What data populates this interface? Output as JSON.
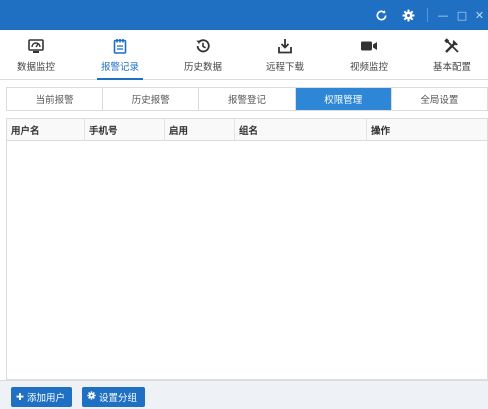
{
  "window": {
    "controls": {
      "refresh": "refresh-icon",
      "settings": "gear-icon",
      "minimize": "—",
      "maximize": "□",
      "close": "✕"
    }
  },
  "nav": {
    "items": [
      {
        "label": "数据监控",
        "icon": "monitor-icon"
      },
      {
        "label": "报警记录",
        "icon": "alarm-clipboard-icon",
        "active": true
      },
      {
        "label": "历史数据",
        "icon": "history-clock-icon"
      },
      {
        "label": "远程下载",
        "icon": "download-tray-icon"
      },
      {
        "label": "视频监控",
        "icon": "video-camera-icon"
      },
      {
        "label": "基本配置",
        "icon": "tools-icon"
      }
    ]
  },
  "tabs": [
    {
      "label": "当前报警"
    },
    {
      "label": "历史报警"
    },
    {
      "label": "报警登记"
    },
    {
      "label": "权限管理",
      "active": true
    },
    {
      "label": "全局设置"
    }
  ],
  "table": {
    "columns": [
      "用户名",
      "手机号",
      "启用",
      "组名",
      "操作"
    ],
    "rows": []
  },
  "footer": {
    "add_user": "添加用户",
    "set_group": "设置分组"
  },
  "colors": {
    "accent": "#1f6fc2",
    "tab_active": "#2e86d6"
  }
}
